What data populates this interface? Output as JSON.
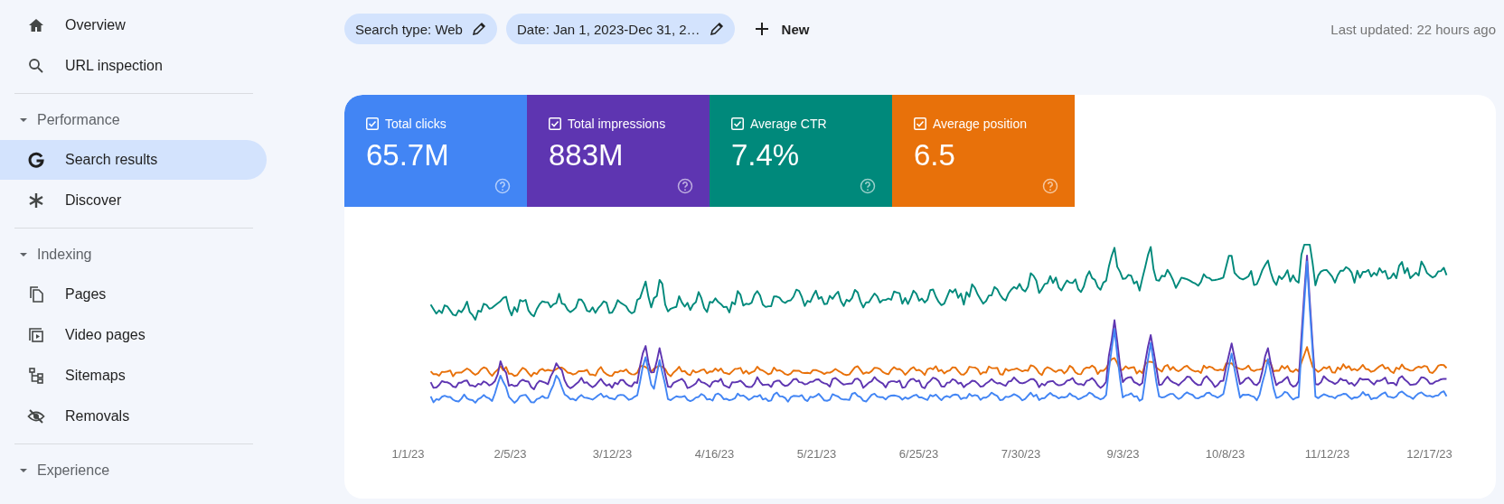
{
  "sidebar": {
    "groups": [
      {
        "items": [
          {
            "label": "Overview",
            "selected": false
          },
          {
            "label": "URL inspection",
            "selected": false
          }
        ]
      },
      {
        "title": "Performance",
        "expanded": true,
        "items": [
          {
            "label": "Search results",
            "selected": true
          },
          {
            "label": "Discover",
            "selected": false
          }
        ]
      },
      {
        "title": "Indexing",
        "expanded": true,
        "items": [
          {
            "label": "Pages",
            "selected": false
          },
          {
            "label": "Video pages",
            "selected": false
          },
          {
            "label": "Sitemaps",
            "selected": false
          },
          {
            "label": "Removals",
            "selected": false
          }
        ]
      },
      {
        "title": "Experience",
        "expanded": true
      }
    ]
  },
  "filters": [
    {
      "label": "Search type: Web"
    },
    {
      "label": "Date: Jan 1, 2023-Dec 31, 2…"
    }
  ],
  "new_button": {
    "label": "New"
  },
  "last_updated": "Last updated: 22 hours ago",
  "cards": [
    {
      "label": "Total clicks",
      "value": "65.7M",
      "checked": true,
      "color": "#4285f4"
    },
    {
      "label": "Total impressions",
      "value": "883M",
      "checked": true,
      "color": "#5e35b1"
    },
    {
      "label": "Average CTR",
      "value": "7.4%",
      "checked": true,
      "color": "#00897b"
    },
    {
      "label": "Average position",
      "value": "6.5",
      "checked": true,
      "color": "#e8710a"
    }
  ],
  "chart": {
    "x_labels": [
      "1/1/23",
      "2/5/23",
      "3/12/23",
      "4/16/23",
      "5/21/23",
      "6/25/23",
      "7/30/23",
      "9/3/23",
      "10/8/23",
      "11/12/23",
      "12/17/23"
    ]
  }
}
